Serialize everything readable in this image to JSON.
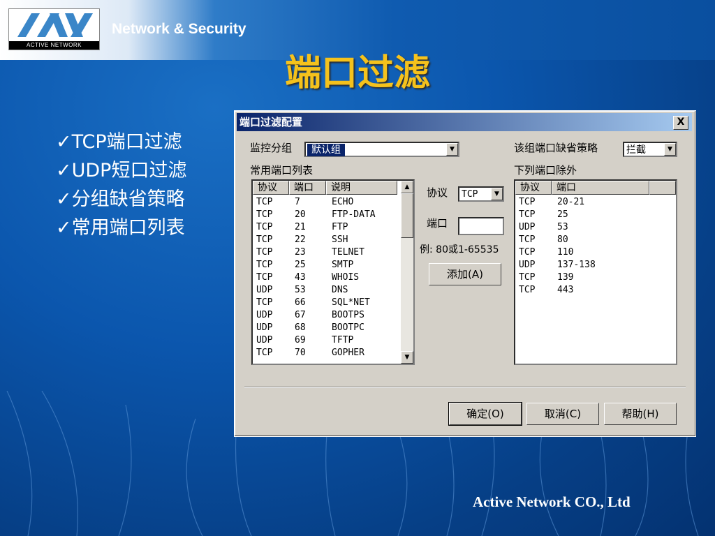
{
  "slide": {
    "brand": "Network & Security",
    "logo_text": "ACTIVE NETWORK",
    "title": "端口过滤",
    "bullets": [
      "✓TCP端口过滤",
      "✓UDP短口过滤",
      "✓分组缺省策略",
      "✓常用端口列表"
    ],
    "footer": "Active Network CO., Ltd"
  },
  "dialog": {
    "title": "端口过滤配置",
    "close_glyph": "X",
    "group_label": "监控分组",
    "group_value": "默认组",
    "policy_label": "该组端口缺省策略",
    "policy_value": "拦截",
    "common_ports_label": "常用端口列表",
    "except_label": "下列端口除外",
    "common_columns": [
      "协议",
      "端口",
      "说明"
    ],
    "common_rows": [
      [
        "TCP",
        "7",
        "ECHO"
      ],
      [
        "TCP",
        "20",
        "FTP-DATA"
      ],
      [
        "TCP",
        "21",
        "FTP"
      ],
      [
        "TCP",
        "22",
        "SSH"
      ],
      [
        "TCP",
        "23",
        "TELNET"
      ],
      [
        "TCP",
        "25",
        "SMTP"
      ],
      [
        "TCP",
        "43",
        "WHOIS"
      ],
      [
        "UDP",
        "53",
        "DNS"
      ],
      [
        "TCP",
        "66",
        "SQL*NET"
      ],
      [
        "UDP",
        "67",
        "BOOTPS"
      ],
      [
        "UDP",
        "68",
        "BOOTPC"
      ],
      [
        "UDP",
        "69",
        "TFTP"
      ],
      [
        "TCP",
        "70",
        "GOPHER"
      ]
    ],
    "protocol_label": "协议",
    "protocol_value": "TCP",
    "port_label": "端口",
    "port_value": "",
    "example_text": "例: 80或1-65535",
    "add_button": "添加(A)",
    "except_columns": [
      "协议",
      "端口"
    ],
    "except_rows": [
      [
        "TCP",
        "20-21"
      ],
      [
        "TCP",
        "25"
      ],
      [
        "UDP",
        "53"
      ],
      [
        "TCP",
        "80"
      ],
      [
        "TCP",
        "110"
      ],
      [
        "UDP",
        "137-138"
      ],
      [
        "TCP",
        "139"
      ],
      [
        "TCP",
        "443"
      ]
    ],
    "ok_button": "确定(O)",
    "cancel_button": "取消(C)",
    "help_button": "帮助(H)"
  },
  "colors": {
    "title": "#f5c21c",
    "background": "#0b56ad",
    "dialog_face": "#d4d0c8",
    "titlebar": "#0a246a"
  }
}
